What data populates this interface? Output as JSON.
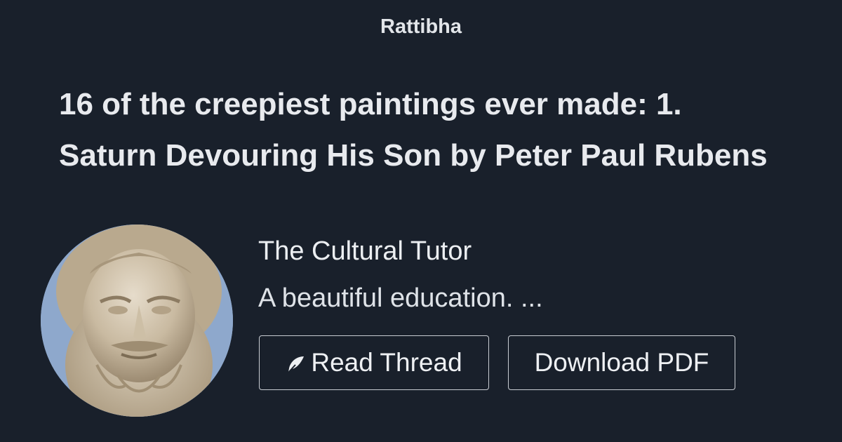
{
  "brand": "Rattibha",
  "thread": {
    "title": "16 of the creepiest paintings ever made: 1. Saturn Devouring His Son by Peter Paul Rubens"
  },
  "author": {
    "name": "The Cultural Tutor",
    "bio": "A beautiful education. ...",
    "avatar_icon": "classical-bust-portrait"
  },
  "actions": {
    "read_label": "Read Thread",
    "read_icon": "feather-icon",
    "pdf_label": "Download PDF"
  },
  "colors": {
    "background": "#19202b",
    "text": "#e8eaee",
    "button_border": "#c8ccd2"
  }
}
